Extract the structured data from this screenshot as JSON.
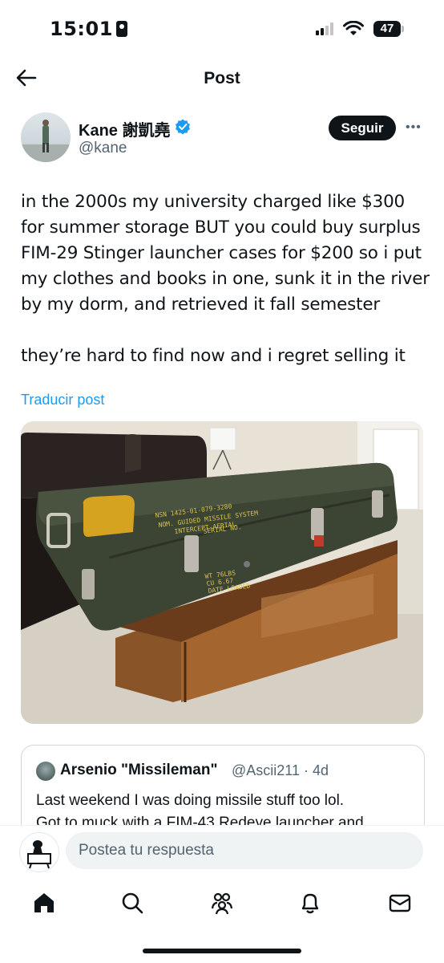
{
  "status_bar": {
    "time": "15:01",
    "battery": "47"
  },
  "header": {
    "title": "Post"
  },
  "post": {
    "author_name": "Kane 謝凱堯",
    "handle": "@kane",
    "follow_label": "Seguir",
    "text": "in the 2000s my university charged like $300\nfor summer storage BUT you could buy surplus\nFIM-29 Stinger launcher cases for $200 so i put\nmy clothes and books in one, sunk it in the river\nby my dorm, and retrieved it fall semester\n\nthey’re hard to find now and i regret selling it",
    "translate_label": "Traducir post",
    "media": {
      "case_stencil": [
        "NSN 1425-01-079-3280",
        "NOM. GUIDED MISSILE SYSTEM",
        "INTERCEPT-AERIAL",
        "SERIAL NO.",
        "WT 76LBS",
        "CU 6.67",
        "DATE LOADED"
      ]
    }
  },
  "quote": {
    "name": "Arsenio \"Missileman\"",
    "handle_time": "@Ascii211 · 4d",
    "text": "Last weekend I was doing missile stuff too lol.\nGot to muck with a FIM-43 Redeye launcher and"
  },
  "reply": {
    "placeholder": "Postea tu respuesta"
  },
  "nav": {
    "icons": [
      "home-icon",
      "search-icon",
      "communities-icon",
      "notifications-icon",
      "messages-icon"
    ]
  },
  "colors": {
    "accent": "#1d9bf0",
    "text": "#0f1419",
    "muted": "#536471"
  }
}
